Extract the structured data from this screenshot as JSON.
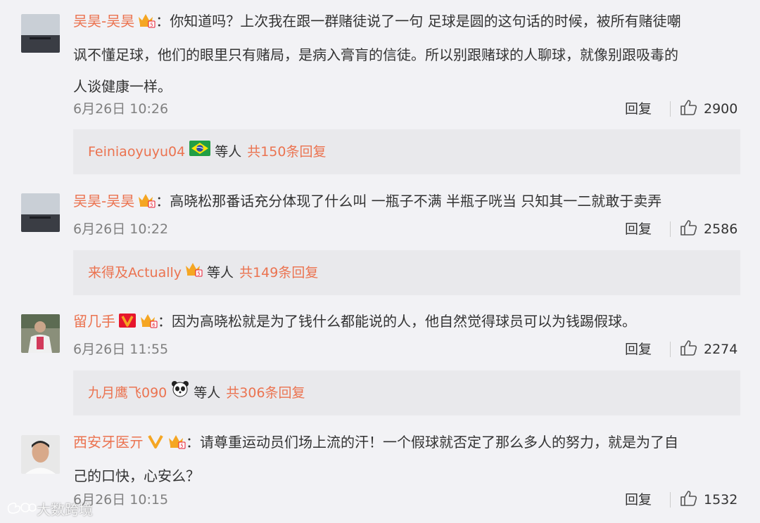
{
  "comments": [
    {
      "user": "吴昊-吴昊",
      "text_lines": [
        "：你知道吗？上次我在跟一群赌徒说了一句 足球是圆的这句话的时候，被所有赌徒嘲",
        "讽不懂足球，他们的眼里只有赌局，是病入膏肓的信徒。所以别跟赌球的人聊球，就像别跟吸毒的",
        "人谈健康一样。"
      ],
      "time": "6月26日 10:26",
      "reply_label": "回复",
      "likes": "2900",
      "replies": {
        "user": "Feiniaoyuyu04",
        "etc": "等人",
        "count": "共150条回复"
      }
    },
    {
      "user": "吴昊-吴昊",
      "text_lines": [
        "：高晓松那番话充分体现了什么叫 一瓶子不满 半瓶子咣当 只知其一二就敢于卖弄"
      ],
      "time": "6月26日 10:22",
      "reply_label": "回复",
      "likes": "2586",
      "replies": {
        "user": "来得及Actually",
        "etc": "等人",
        "count": "共149条回复"
      }
    },
    {
      "user": "留几手",
      "text_lines": [
        "：因为高晓松就是为了钱什么都能说的人，他自然觉得球员可以为钱踢假球。"
      ],
      "time": "6月26日 11:55",
      "reply_label": "回复",
      "likes": "2274",
      "replies": {
        "user": "九月鹰飞090",
        "etc": "等人",
        "count": "共306条回复"
      }
    },
    {
      "user": "西安牙医亓",
      "text_lines": [
        "：请尊重运动员们场上流的汗！一个假球就否定了那么多人的努力，就是为了自",
        "己的口快，心安么？"
      ],
      "time": "6月26日 10:15",
      "reply_label": "回复",
      "likes": "1532"
    }
  ],
  "badge": {
    "crown_color": "#f5a623",
    "v_color": "#f5a623",
    "v_red": "#e6162d"
  },
  "watermark": "大数跨境"
}
